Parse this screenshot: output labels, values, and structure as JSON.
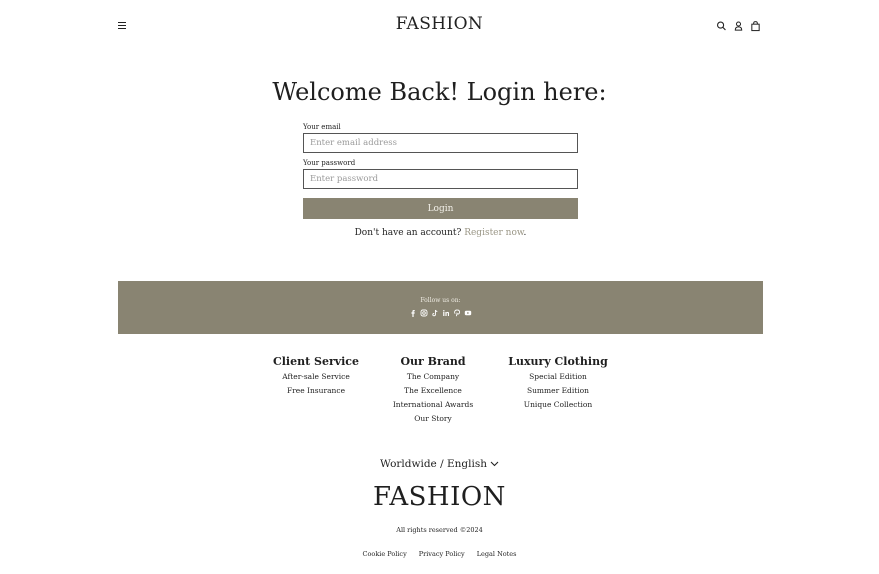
{
  "header": {
    "brand": "FASHION",
    "icons": [
      "menu-icon",
      "search-icon",
      "user-icon",
      "bag-icon"
    ]
  },
  "login": {
    "title": "Welcome Back! Login here:",
    "email_label": "Your email",
    "email_placeholder": "Enter email address",
    "password_label": "Your password",
    "password_placeholder": "Enter password",
    "button_label": "Login",
    "register_prompt": "Don't have an account?",
    "register_link": "Register now",
    "register_suffix": "."
  },
  "follow": {
    "label": "Follow us on:",
    "icons": [
      "facebook-icon",
      "instagram-icon",
      "tiktok-icon",
      "linkedin-icon",
      "pinterest-icon",
      "youtube-icon"
    ]
  },
  "footer": {
    "columns": [
      {
        "heading": "Client Service",
        "items": [
          "After-sale Service",
          "Free Insurance"
        ]
      },
      {
        "heading": "Our Brand",
        "items": [
          "The Company",
          "The Excellence",
          "International Awards",
          "Our Story"
        ]
      },
      {
        "heading": "Luxury Clothing",
        "items": [
          "Special Edition",
          "Summer Edition",
          "Unique Collection"
        ]
      }
    ],
    "language": "Worldwide / English",
    "brand": "FASHION",
    "rights": "All rights reserved ©2024",
    "legal": [
      "Cookie Policy",
      "Privacy Policy",
      "Legal Notes"
    ]
  },
  "colors": {
    "accent": "#898472",
    "link": "#9a9686",
    "text": "#1f1f1f"
  }
}
